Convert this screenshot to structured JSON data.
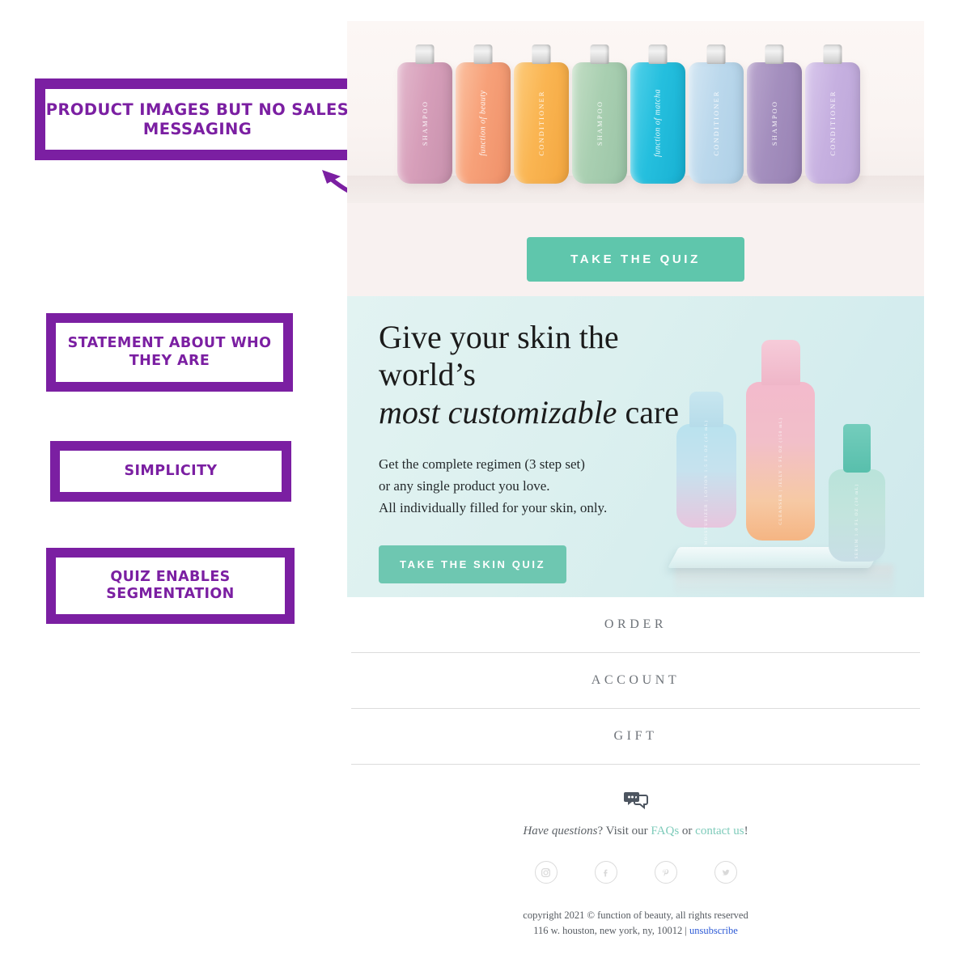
{
  "annotations": [
    {
      "id": "product-images-no-sales",
      "text": "PRODUCT IMAGES BUT NO SALES MESSAGING"
    },
    {
      "id": "statement-who-they-are",
      "text": "STATEMENT ABOUT WHO THEY ARE"
    },
    {
      "id": "simplicity",
      "text": "SIMPLICITY"
    },
    {
      "id": "quiz-enables-segmentation",
      "text": "QUIZ ENABLES SEGMENTATION"
    }
  ],
  "annotation_color": "#7B1FA2",
  "arrow": {
    "name": "curved-arrow",
    "color": "#7B1FA2"
  },
  "email": {
    "hero": {
      "background": "#F8F1F0",
      "bottles": [
        {
          "label": "SHAMPOO",
          "style": "caps",
          "color": "#D9A7BE"
        },
        {
          "label": "function of beauty",
          "style": "script",
          "color": "#F8A379"
        },
        {
          "label": "CONDITIONER",
          "style": "caps",
          "color": "#F9B košt"
        },
        {
          "label": "SHAMPOO",
          "style": "caps",
          "color": "#A7CFB2"
        },
        {
          "label": "function of matcha",
          "style": "script",
          "color": "#2FC3E0"
        },
        {
          "label": "CONDITIONER",
          "style": "caps",
          "color": "#BDD9EC"
        },
        {
          "label": "SHAMPOO",
          "style": "caps",
          "color": "#A793C0"
        },
        {
          "label": "CONDITIONER",
          "style": "caps",
          "color": "#C8B3DF"
        }
      ],
      "cta_label": "TAKE THE QUIZ",
      "cta_color": "#5FC6AC"
    },
    "skin": {
      "background": "#DCF0EF",
      "headline_line1": "Give your skin the world’s",
      "headline_italic": "most customizable",
      "headline_tail": " care",
      "body_line1": "Get the complete regimen (3 step set)",
      "body_line2": "or any single product you love.",
      "body_line3": "All individually filled for your skin, only.",
      "cta_label": "TAKE THE SKIN QUIZ",
      "cta_color": "#6EC7B1",
      "products": [
        {
          "label": "MOISTURIZER | LOTION  1.5 FL OZ (45 mL)"
        },
        {
          "label": "CLEANSER | JELLY  5 FL OZ (150 mL)"
        },
        {
          "label": "SERUM  1.0 FL OZ (30 mL)"
        }
      ]
    },
    "nav": [
      {
        "label": "ORDER"
      },
      {
        "label": "ACCOUNT"
      },
      {
        "label": "GIFT"
      }
    ],
    "footer": {
      "chat_icon": "speech-bubbles-icon",
      "help_italic": "Have questions",
      "help_mid": "? Visit our ",
      "help_link1": "FAQs",
      "help_or": " or ",
      "help_link2": "contact us",
      "help_end": "!",
      "link_color": "#7ECBBA",
      "socials": [
        {
          "name": "instagram-icon",
          "glyph": "instagram"
        },
        {
          "name": "facebook-icon",
          "glyph": "facebook"
        },
        {
          "name": "pinterest-icon",
          "glyph": "pinterest"
        },
        {
          "name": "twitter-icon",
          "glyph": "twitter"
        }
      ],
      "copyright_line1": "copyright 2021 © function of beauty, all rights reserved",
      "address": "116 w. houston, new york, ny, 10012  |  ",
      "unsubscribe": "unsubscribe",
      "unsubscribe_color": "#2E5BD6"
    }
  }
}
